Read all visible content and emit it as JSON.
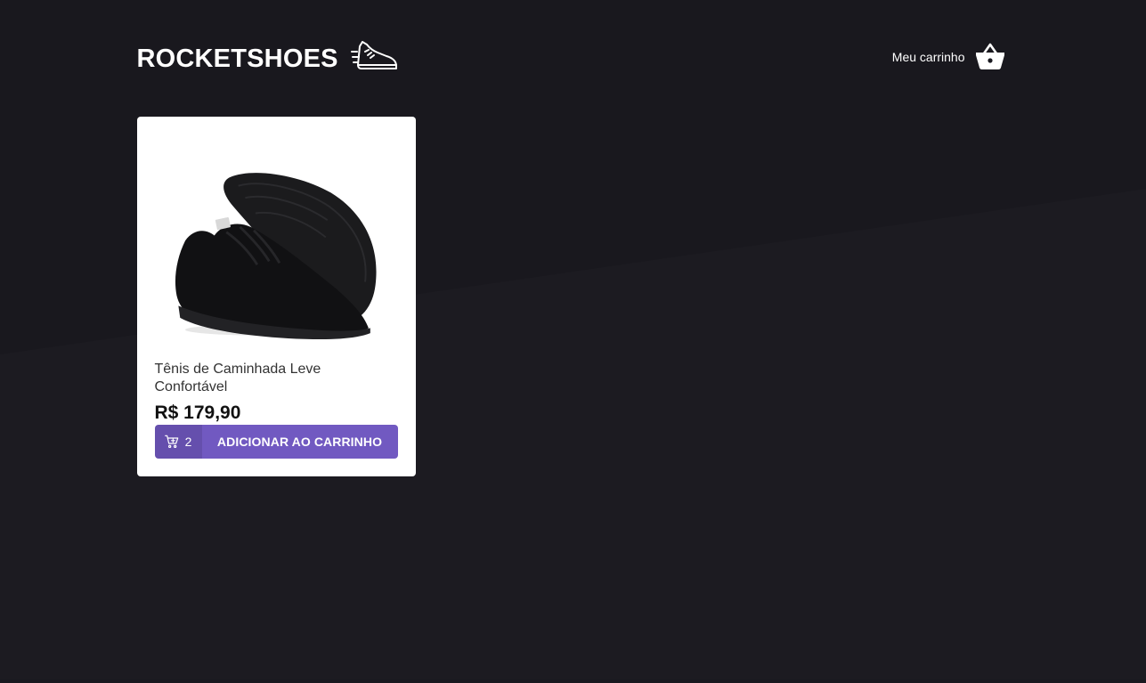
{
  "header": {
    "logo_text": "ROCKETSHOES",
    "logo_icon": "running-shoe-icon",
    "cart_label": "Meu carrinho",
    "cart_icon": "shopping-basket-icon"
  },
  "products": [
    {
      "title": "Tênis de Caminhada Leve Confortável",
      "price": "R$ 179,90",
      "image": "black-sneaker-image",
      "cart_amount": "2",
      "cart_amount_icon": "add-shopping-cart-icon",
      "button_label": "ADICIONAR AO CARRINHO"
    }
  ],
  "colors": {
    "background": "#191920",
    "background_stripe": "#1c1c22",
    "accent": "#7159c1",
    "card": "#ffffff"
  }
}
